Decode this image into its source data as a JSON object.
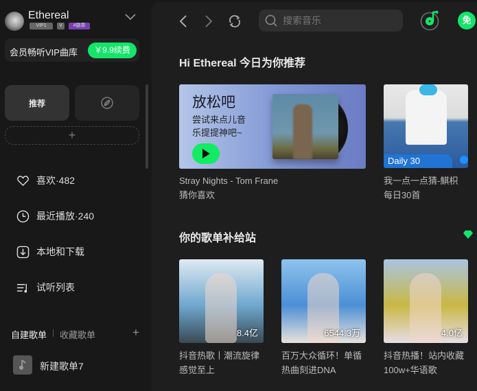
{
  "user": {
    "name": "Ethereal",
    "badges": [
      "VIP1",
      "V",
      "4徽章"
    ]
  },
  "vip": {
    "text": "会员畅听VIP曲库",
    "button": "￥9.9续费"
  },
  "tabs": {
    "recommend": "推荐"
  },
  "menu": [
    {
      "label": "喜欢·482",
      "icon": "heart-icon"
    },
    {
      "label": "最近播放·240",
      "icon": "clock-icon"
    },
    {
      "label": "本地和下载",
      "icon": "download-icon"
    },
    {
      "label": "试听列表",
      "icon": "playlist-icon"
    }
  ],
  "playlists": {
    "tab_created": "自建歌单",
    "tab_collected": "收藏歌单",
    "items": [
      "新建歌单7"
    ]
  },
  "topbar": {
    "search_placeholder": "搜索音乐",
    "free_badge": "免"
  },
  "section1": {
    "title": "Hi Ethereal 今日为你推荐",
    "banner": {
      "title": "放松吧",
      "line1": "尝试来点儿音",
      "line2": "乐提提神吧~",
      "caption1": "Stray Nights - Tom Frane",
      "caption2": "猜你喜欢"
    },
    "daily": {
      "label": "Daily 30",
      "caption1": "我一点一点猜-鯕枳",
      "caption2": "每日30首"
    }
  },
  "section2": {
    "title": "你的歌单补给站",
    "cards": [
      {
        "count": "8.4亿",
        "line1": "抖音热歌丨潮流旋律",
        "line2": "感觉至上",
        "colors": [
          "#dfe9f2",
          "#6fa8d0",
          "#3a4a55"
        ]
      },
      {
        "count": "6544.3万",
        "line1": "百万大众循环！单循",
        "line2": "热曲刻进DNA",
        "colors": [
          "#8ec3ec",
          "#4c8fd6",
          "#e8e2dc"
        ]
      },
      {
        "count": "4.0亿",
        "line1": "抖音热播！站内收藏",
        "line2": "100w+华语歌",
        "colors": [
          "#a9c4e0",
          "#c9b845",
          "#e6dde8"
        ]
      }
    ]
  },
  "colors": {
    "accent": "#14e56a"
  }
}
